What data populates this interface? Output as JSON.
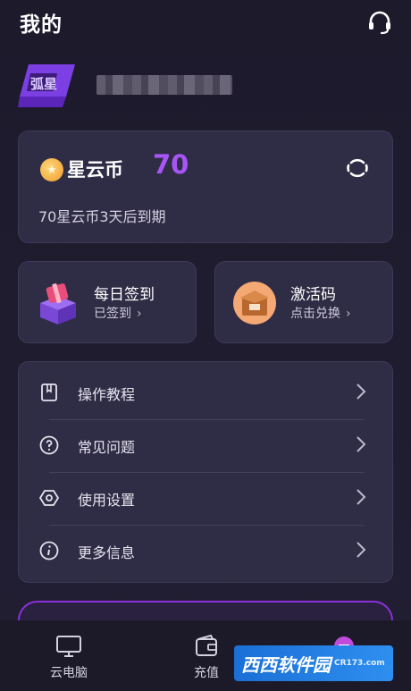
{
  "header": {
    "title": "我的"
  },
  "profile": {
    "avatar_text": "弧星"
  },
  "coins": {
    "label": "星云币",
    "value": "70",
    "expiry": "70星云币3天后到期"
  },
  "tiles": [
    {
      "title": "每日签到",
      "sub": "已签到"
    },
    {
      "title": "激活码",
      "sub": "点击兑换"
    }
  ],
  "menu": [
    {
      "label": "操作教程",
      "icon": "book-icon"
    },
    {
      "label": "常见问题",
      "icon": "question-icon"
    },
    {
      "label": "使用设置",
      "icon": "settings-icon"
    },
    {
      "label": "更多信息",
      "icon": "info-icon"
    }
  ],
  "tabs": [
    {
      "label": "云电脑",
      "icon": "monitor-icon"
    },
    {
      "label": "充值",
      "icon": "wallet-icon"
    },
    {
      "label": "",
      "icon": "profile-icon"
    }
  ],
  "watermark": {
    "text": "西西软件园",
    "sub": "CR173.com"
  },
  "colors": {
    "accent": "#a855f7",
    "card": "#2f2c45",
    "background": "#1d1a2c"
  }
}
